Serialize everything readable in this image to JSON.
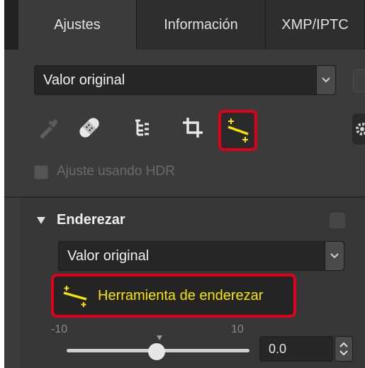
{
  "tabs": [
    {
      "label": "Ajustes",
      "active": true
    },
    {
      "label": "Información",
      "active": false
    },
    {
      "label": "XMP/IPTC",
      "active": false
    }
  ],
  "preset": {
    "value": "Valor original"
  },
  "tools": [
    {
      "icon": "eyedropper-icon",
      "enabled": false
    },
    {
      "icon": "bandage-icon",
      "enabled": true
    },
    {
      "icon": "tree-icon",
      "enabled": true
    },
    {
      "icon": "crop-icon",
      "enabled": true
    },
    {
      "icon": "straighten-icon",
      "enabled": true,
      "selected": true
    }
  ],
  "hdr": {
    "label": "Ajuste usando HDR",
    "checked": false,
    "enabled": false
  },
  "section": {
    "title": "Enderezar",
    "expanded": true,
    "preset": {
      "value": "Valor original"
    },
    "tool_button": {
      "label": "Herramienta de enderezar",
      "icon": "straighten-icon"
    },
    "slider": {
      "min_label": "-10",
      "max_label": "10",
      "value": "0.0",
      "min": -10,
      "max": 10,
      "current": 0
    }
  },
  "colors": {
    "accent_yellow": "#f5e500",
    "highlight_red": "#e0001b",
    "panel": "#3b3b3b",
    "field": "#262626"
  }
}
